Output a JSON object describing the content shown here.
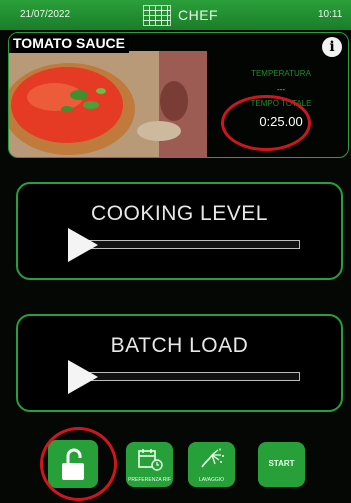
{
  "header": {
    "date": "21/07/2022",
    "title": "CHEF",
    "time": "10:11"
  },
  "recipe": {
    "name": "TOMATO SAUCE",
    "temperature_label": "TEMPERATURA",
    "temperature_value": "---",
    "total_time_label": "TEMPO TOTALE",
    "total_time_value": "0:25.00"
  },
  "cooking_level": {
    "label": "COOKING LEVEL",
    "level": 0
  },
  "batch_load": {
    "label": "BATCH LOAD",
    "level": 0
  },
  "toolbar": {
    "reference_label": "PREFERENZA RIF",
    "washing_label": "LAVAGGIO",
    "start_label": "START"
  },
  "colors": {
    "header_green": "#27a03a",
    "annotation_red": "#d0161c",
    "background": "#050705"
  },
  "icons": [
    "lock-open-icon",
    "calendar-clock-icon",
    "washing-icon",
    "info-icon",
    "chef-logo-icon"
  ]
}
